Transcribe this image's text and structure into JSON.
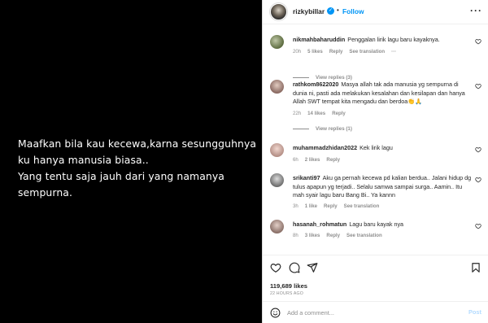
{
  "media": {
    "lines": [
      "Maafkan bila kau kecewa,karna sesungguhnya",
      "ku hanya manusia biasa..",
      "Yang tentu saja jauh dari yang namanya",
      "sempurna."
    ]
  },
  "header": {
    "username": "rizkybillar",
    "separator": "•",
    "follow_label": "Follow",
    "more_label": "···"
  },
  "comments": [
    {
      "user": "nikmahbaharuddin",
      "text": "Penggalan lirik lagu baru kayaknya.",
      "time": "20h",
      "likes": "5 likes",
      "reply": "Reply",
      "translate": "See translation",
      "more": "···",
      "view_replies": "View replies (3)"
    },
    {
      "user": "rathkom8622020",
      "text": "Masya allah tak ada manusia yg sempurna di dunia ni, pasti ada melakukan kesalahan dan kesilapan dan hanya Allah SWT tempat kita mengadu dan berdoa👏🙏",
      "time": "22h",
      "likes": "14 likes",
      "reply": "Reply",
      "view_replies": "View replies (1)"
    },
    {
      "user": "muhammadzhidan2022",
      "text": "Kek lirik lagu",
      "time": "6h",
      "likes": "2 likes",
      "reply": "Reply"
    },
    {
      "user": "srikanti97",
      "text": "Aku ga pernah kecewa pd kalian berdua.. Jalani hidup dg tulus apapun yg terjadi.. Selalu samwa sampai surga.. Aamin.. Itu mah syair lagu baru Bang Bi.. Ya kannn",
      "time": "3h",
      "likes": "1 like",
      "reply": "Reply",
      "translate": "See translation"
    },
    {
      "user": "hasanah_rohmatun",
      "text": "Lagu baru kayak nya",
      "time": "8h",
      "likes": "3 likes",
      "reply": "Reply",
      "translate": "See translation"
    }
  ],
  "actions": {
    "likes": "119,689 likes",
    "time_ago": "22 HOURS AGO"
  },
  "add_comment": {
    "placeholder": "Add a comment...",
    "post_label": "Post"
  },
  "colors": {
    "accent": "#0095f6",
    "muted": "#8e8e8e",
    "text": "#262626",
    "post_disabled": "#b3dbff"
  }
}
